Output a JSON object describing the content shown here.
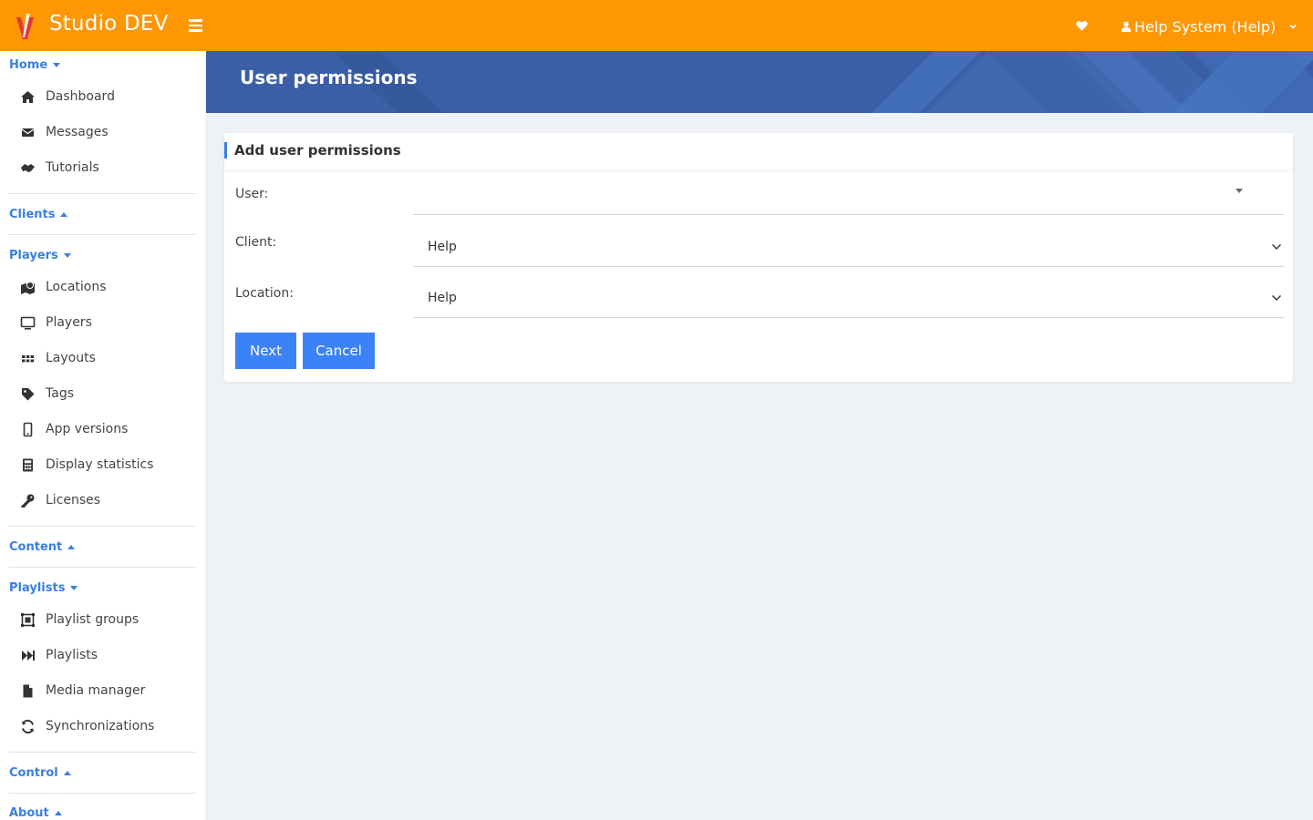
{
  "app": {
    "brand": "Studio DEV",
    "user_label": "Help System (Help)"
  },
  "colors": {
    "topbar": "#fe9704",
    "accent": "#3a7fe0",
    "button": "#3b82f6",
    "header": "#3a5fa6"
  },
  "sidebar": {
    "sections": {
      "home": {
        "label": "Home",
        "state": "expanded"
      },
      "clients": {
        "label": "Clients",
        "state": "collapsed"
      },
      "players": {
        "label": "Players",
        "state": "expanded"
      },
      "content": {
        "label": "Content",
        "state": "collapsed"
      },
      "playlists": {
        "label": "Playlists",
        "state": "expanded"
      },
      "control": {
        "label": "Control",
        "state": "collapsed"
      },
      "about": {
        "label": "About",
        "state": "collapsed"
      }
    },
    "items": {
      "dashboard": "Dashboard",
      "messages": "Messages",
      "tutorials": "Tutorials",
      "locations": "Locations",
      "players": "Players",
      "layouts": "Layouts",
      "tags": "Tags",
      "app_versions": "App versions",
      "display_statistics": "Display statistics",
      "licenses": "Licenses",
      "playlist_groups": "Playlist groups",
      "playlists": "Playlists",
      "media_manager": "Media manager",
      "synchronizations": "Synchronizations"
    }
  },
  "page": {
    "title": "User permissions"
  },
  "form": {
    "card_title": "Add user permissions",
    "user": {
      "label": "User:",
      "value": ""
    },
    "client": {
      "label": "Client:",
      "value": "Help"
    },
    "location": {
      "label": "Location:",
      "value": "Help"
    },
    "next_label": "Next",
    "cancel_label": "Cancel"
  }
}
